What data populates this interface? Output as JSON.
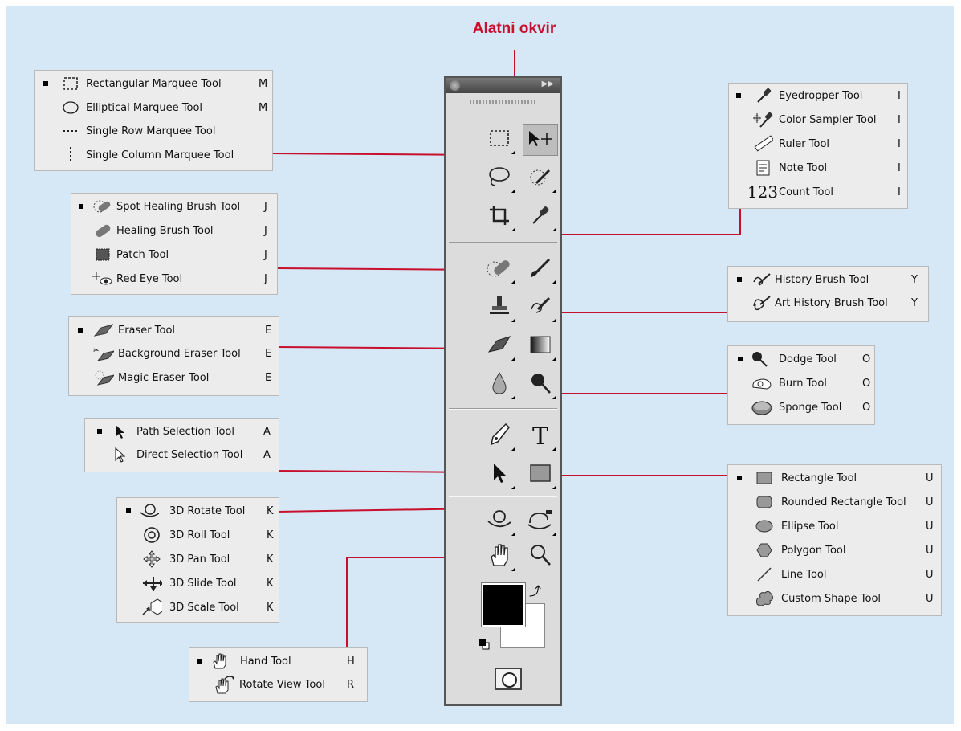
{
  "title": "Alatni okvir",
  "colors": {
    "accent_red": "#c8102e",
    "background": "#d6e7f6",
    "panel": "#ececec"
  },
  "groups": {
    "marquee": [
      {
        "label": "Rectangular Marquee Tool",
        "key": "M",
        "icon": "rectangular-marquee-icon",
        "active": true
      },
      {
        "label": "Elliptical Marquee Tool",
        "key": "M",
        "icon": "elliptical-marquee-icon"
      },
      {
        "label": "Single Row Marquee Tool",
        "key": "",
        "icon": "single-row-marquee-icon"
      },
      {
        "label": "Single Column Marquee Tool",
        "key": "",
        "icon": "single-column-marquee-icon"
      }
    ],
    "healing": [
      {
        "label": "Spot Healing Brush Tool",
        "key": "J",
        "icon": "spot-healing-brush-icon",
        "active": true
      },
      {
        "label": "Healing Brush Tool",
        "key": "J",
        "icon": "healing-brush-icon"
      },
      {
        "label": "Patch Tool",
        "key": "J",
        "icon": "patch-icon"
      },
      {
        "label": "Red Eye Tool",
        "key": "J",
        "icon": "red-eye-icon"
      }
    ],
    "eraser": [
      {
        "label": "Eraser Tool",
        "key": "E",
        "icon": "eraser-icon",
        "active": true
      },
      {
        "label": "Background Eraser Tool",
        "key": "E",
        "icon": "background-eraser-icon"
      },
      {
        "label": "Magic Eraser Tool",
        "key": "E",
        "icon": "magic-eraser-icon"
      }
    ],
    "selection": [
      {
        "label": "Path Selection Tool",
        "key": "A",
        "icon": "path-selection-icon",
        "active": true
      },
      {
        "label": "Direct Selection Tool",
        "key": "A",
        "icon": "direct-selection-icon"
      }
    ],
    "three_d": [
      {
        "label": "3D Rotate Tool",
        "key": "K",
        "icon": "3d-rotate-icon",
        "active": true
      },
      {
        "label": "3D Roll Tool",
        "key": "K",
        "icon": "3d-roll-icon"
      },
      {
        "label": "3D Pan Tool",
        "key": "K",
        "icon": "3d-pan-icon"
      },
      {
        "label": "3D Slide Tool",
        "key": "K",
        "icon": "3d-slide-icon"
      },
      {
        "label": "3D Scale Tool",
        "key": "K",
        "icon": "3d-scale-icon"
      }
    ],
    "hand": [
      {
        "label": "Hand Tool",
        "key": "H",
        "icon": "hand-icon",
        "active": true
      },
      {
        "label": "Rotate View Tool",
        "key": "R",
        "icon": "rotate-view-icon"
      }
    ],
    "eyedropper": [
      {
        "label": "Eyedropper Tool",
        "key": "I",
        "icon": "eyedropper-icon",
        "active": true
      },
      {
        "label": "Color Sampler Tool",
        "key": "I",
        "icon": "color-sampler-icon"
      },
      {
        "label": "Ruler Tool",
        "key": "I",
        "icon": "ruler-icon"
      },
      {
        "label": "Note Tool",
        "key": "I",
        "icon": "note-icon"
      },
      {
        "label": "Count Tool",
        "key": "I",
        "icon": "count-icon",
        "icon_text": "123"
      }
    ],
    "history": [
      {
        "label": "History Brush Tool",
        "key": "Y",
        "icon": "history-brush-icon",
        "active": true
      },
      {
        "label": "Art History Brush Tool",
        "key": "Y",
        "icon": "art-history-brush-icon"
      }
    ],
    "dodge": [
      {
        "label": "Dodge Tool",
        "key": "O",
        "icon": "dodge-icon",
        "active": true
      },
      {
        "label": "Burn Tool",
        "key": "O",
        "icon": "burn-icon"
      },
      {
        "label": "Sponge Tool",
        "key": "O",
        "icon": "sponge-icon"
      }
    ],
    "shape": [
      {
        "label": "Rectangle Tool",
        "key": "U",
        "icon": "rectangle-shape-icon",
        "active": true
      },
      {
        "label": "Rounded Rectangle Tool",
        "key": "U",
        "icon": "rounded-rectangle-icon"
      },
      {
        "label": "Ellipse Tool",
        "key": "U",
        "icon": "ellipse-shape-icon"
      },
      {
        "label": "Polygon Tool",
        "key": "U",
        "icon": "polygon-icon"
      },
      {
        "label": "Line Tool",
        "key": "U",
        "icon": "line-icon"
      },
      {
        "label": "Custom Shape Tool",
        "key": "U",
        "icon": "custom-shape-icon"
      }
    ]
  },
  "toolbox": {
    "tools": [
      "rectangular-marquee-icon",
      "move-icon",
      "lasso-icon",
      "quick-selection-icon",
      "crop-icon",
      "eyedropper-icon",
      "spot-healing-brush-icon",
      "brush-icon",
      "clone-stamp-icon",
      "history-brush-icon",
      "eraser-icon",
      "gradient-icon",
      "blur-icon",
      "dodge-icon",
      "pen-icon",
      "type-icon",
      "path-selection-icon",
      "rectangle-shape-icon",
      "3d-rotate-icon",
      "3d-camera-rotate-icon",
      "hand-icon",
      "zoom-icon"
    ],
    "type_glyph": "T",
    "foreground_color": "#000000",
    "background_color": "#ffffff"
  }
}
